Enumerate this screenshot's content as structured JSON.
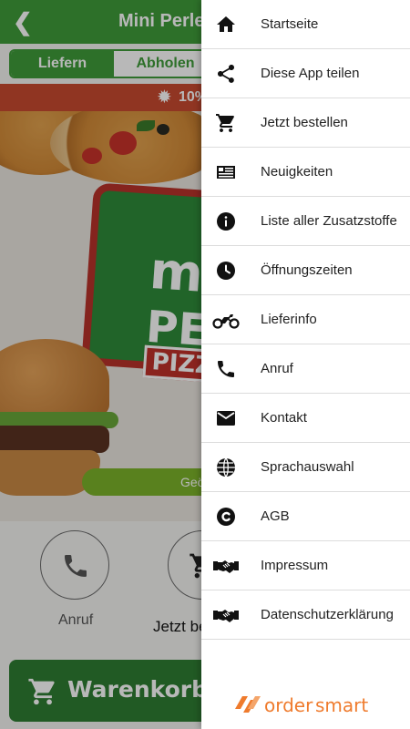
{
  "header": {
    "title": "Mini Perle Pizza"
  },
  "order_toggle": {
    "deliver": "Liefern",
    "pickup": "Abholen"
  },
  "promo": {
    "text": "10%"
  },
  "hero": {
    "logo_line1": "mini",
    "logo_line2": "PERLE",
    "logo_ribbon": "PIZZA",
    "status_pill": "Geöffnet"
  },
  "actions": {
    "call_label": "Anruf",
    "order_label": "Jetzt bestellen"
  },
  "cart": {
    "label": "Warenkorb"
  },
  "menu": {
    "items": [
      {
        "label": "Startseite",
        "icon": "home-icon"
      },
      {
        "label": "Diese App teilen",
        "icon": "share-icon"
      },
      {
        "label": "Jetzt bestellen",
        "icon": "cart-icon"
      },
      {
        "label": "Neuigkeiten",
        "icon": "news-icon"
      },
      {
        "label": "Liste aller Zusatzstoffe",
        "icon": "info-icon"
      },
      {
        "label": "Öffnungszeiten",
        "icon": "clock-icon"
      },
      {
        "label": "Lieferinfo",
        "icon": "motorbike-icon"
      },
      {
        "label": "Anruf",
        "icon": "phone-icon"
      },
      {
        "label": "Kontakt",
        "icon": "mail-icon"
      },
      {
        "label": "Sprachauswahl",
        "icon": "globe-icon"
      },
      {
        "label": "AGB",
        "icon": "copyright-icon"
      },
      {
        "label": "Impressum",
        "icon": "handshake-icon"
      },
      {
        "label": "Datenschutzerklärung",
        "icon": "handshake-icon"
      }
    ]
  },
  "brand": {
    "name_part1": "order",
    "name_part2": "smart"
  },
  "colors": {
    "primary_green": "#3f9b3a",
    "promo_red": "#c84a30",
    "brand_orange": "#ef7b2d"
  }
}
